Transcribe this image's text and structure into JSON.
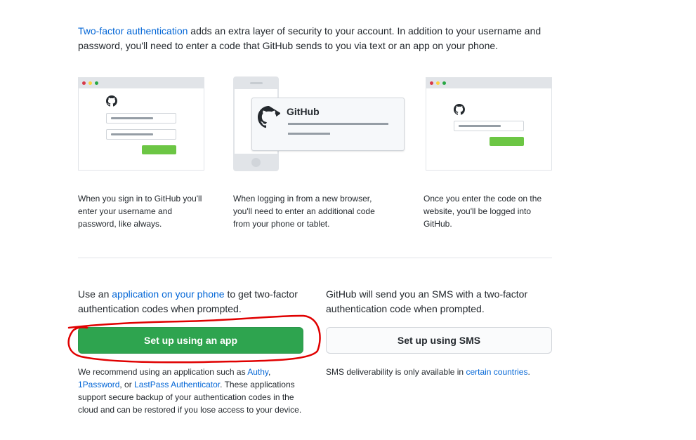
{
  "intro": {
    "link": "Two-factor authentication",
    "text": " adds an extra layer of security to your account. In addition to your username and password, you'll need to enter a code that GitHub sends to you via text or an app on your phone."
  },
  "illustrations": {
    "phone_title": "GitHub"
  },
  "captions": [
    "When you sign in to GitHub you'll enter your username and password, like always.",
    "When logging in from a new browser, you'll need to enter an additional code from your phone or tablet.",
    "Once you enter the code on the website, you'll be logged into GitHub."
  ],
  "app_option": {
    "text_before": "Use an ",
    "link": "application on your phone",
    "text_after": " to get two-factor authentication codes when prompted.",
    "button": "Set up using an app",
    "note_before": "We recommend using an application such as ",
    "authy": "Authy",
    "comma1": ", ",
    "onepassword": "1Password",
    "comma2": ", or ",
    "lastpass": "LastPass Authenticator",
    "note_after": ". These applications support secure backup of your authentication codes in the cloud and can be restored if you lose access to your device."
  },
  "sms_option": {
    "text": "GitHub will send you an SMS with a two-factor authentication code when prompted.",
    "button": "Set up using SMS",
    "note_before": "SMS deliverability is only available in ",
    "link": "certain countries",
    "note_after": "."
  },
  "colors": {
    "primary_button": "#2ea44f",
    "link": "#0366d6",
    "annotation": "#e00000"
  }
}
